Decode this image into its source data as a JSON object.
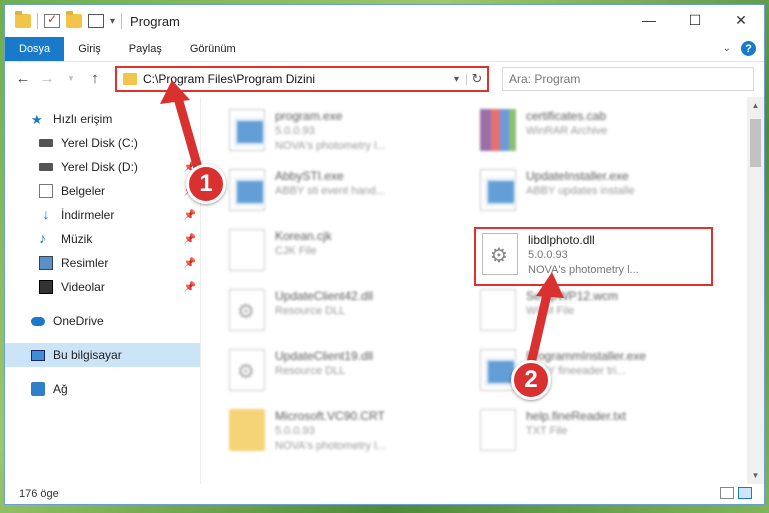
{
  "window": {
    "title": "Program",
    "controls": {
      "minimize": "—",
      "maximize": "☐",
      "close": "✕"
    }
  },
  "ribbon": {
    "tabs": [
      "Dosya",
      "Giriş",
      "Paylaş",
      "Görünüm"
    ]
  },
  "address": {
    "path": "C:\\Program Files\\Program Dizini",
    "search_placeholder": "Ara: Program"
  },
  "sidebar": {
    "items": [
      {
        "label": "Hızlı erişim",
        "icon": "star-icon"
      },
      {
        "label": "Yerel Disk (C:)",
        "icon": "disk-icon"
      },
      {
        "label": "Yerel Disk (D:)",
        "icon": "disk-icon",
        "pinned": true
      },
      {
        "label": "Belgeler",
        "icon": "documents-icon",
        "pinned": true
      },
      {
        "label": "İndirmeler",
        "icon": "download-icon",
        "pinned": true
      },
      {
        "label": "Müzik",
        "icon": "music-icon",
        "pinned": true
      },
      {
        "label": "Resimler",
        "icon": "pictures-icon",
        "pinned": true
      },
      {
        "label": "Videolar",
        "icon": "videos-icon",
        "pinned": true
      },
      {
        "label": "OneDrive",
        "icon": "cloud-icon"
      },
      {
        "label": "Bu bilgisayar",
        "icon": "computer-icon"
      },
      {
        "label": "Ağ",
        "icon": "network-icon"
      }
    ]
  },
  "files": [
    {
      "name": "program.exe",
      "line2": "5.0.0.93",
      "line3": "NOVA's photometry l...",
      "kind": "exe"
    },
    {
      "name": "certificates.cab",
      "line2": "WinRAR Archive",
      "line3": "",
      "kind": "cab"
    },
    {
      "name": "AbbySTI.exe",
      "line2": "ABBY sti event hand...",
      "line3": "",
      "kind": "exe"
    },
    {
      "name": "UpdateInstaller.exe",
      "line2": "ABBY updates installe",
      "line3": "",
      "kind": "exe"
    },
    {
      "name": "Korean.cjk",
      "line2": "CJK File",
      "line3": "",
      "kind": "doc"
    },
    {
      "name": "UpdateClient42.dll",
      "line2": "Resource DLL",
      "line3": "",
      "kind": "gear"
    },
    {
      "name": "SetupWP12.wcm",
      "line2": "WCM File",
      "line3": "",
      "kind": "doc"
    },
    {
      "name": "UpdateClient19.dll",
      "line2": "Resource DLL",
      "line3": "",
      "kind": "gear"
    },
    {
      "name": "ProgrammInstaller.exe",
      "line2": "ABBY fineeader tri...",
      "line3": "",
      "kind": "exe"
    },
    {
      "name": "Microsoft.VC90.CRT",
      "line2": "5.0.0.93",
      "line3": "NOVA's photometry l...",
      "kind": "fold"
    },
    {
      "name": "help.fineReader.txt",
      "line2": "TXT File",
      "line3": "",
      "kind": "doc"
    }
  ],
  "highlighted_file": {
    "name": "libdlphoto.dll",
    "line2": "5.0.0.93",
    "line3": "NOVA's photometry l..."
  },
  "status": {
    "count": "176 öge"
  },
  "callouts": [
    "1",
    "2"
  ]
}
